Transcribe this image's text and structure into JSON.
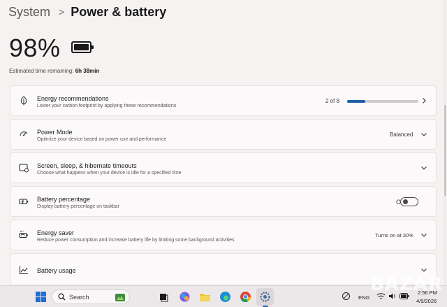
{
  "breadcrumb": {
    "parent": "System",
    "separator": ">",
    "current": "Power & battery"
  },
  "battery": {
    "percent_text": "98%",
    "percent_value": 0.98
  },
  "remaining": {
    "label": "Estimated time remaining:",
    "value": "6h 38min"
  },
  "cards": {
    "energy_recommendations": {
      "title": "Energy recommendations",
      "subtitle": "Lower your carbon footprint by applying these recommendations",
      "count": "2 of 8",
      "progress": 0.25,
      "icon": "leaf-icon"
    },
    "power_mode": {
      "title": "Power Mode",
      "subtitle": "Optimize your device based on power use and performance",
      "value": "Balanced",
      "icon": "power-mode-icon"
    },
    "screen_sleep": {
      "title": "Screen, sleep, & hibernate timeouts",
      "subtitle": "Choose what happens when your device is idle for a specified time",
      "icon": "screen-sleep-icon"
    },
    "battery_percentage": {
      "title": "Battery percentage",
      "subtitle": "Display battery percentage on taskbar",
      "value": "Off",
      "toggle_on": false,
      "icon": "battery-charging-icon"
    },
    "energy_saver": {
      "title": "Energy saver",
      "subtitle": "Reduce power consumption and increase battery life by limiting some background activities",
      "value": "Turns on at 30%",
      "icon": "energy-saver-icon"
    },
    "battery_usage": {
      "title": "Battery usage",
      "icon": "chart-line-icon"
    }
  },
  "taskbar": {
    "search_label": "Search",
    "language": "ENG",
    "time": "2:56 PM",
    "date": "4/9/2026",
    "apps": [
      "windows-start-icon",
      "search-icon",
      "widgets-icon",
      "task-view-icon",
      "copilot-icon",
      "file-explorer-icon",
      "edge-icon",
      "chrome-icon",
      "settings-icon"
    ]
  },
  "watermark": "BAZAR",
  "colors": {
    "accent": "#1f5fa8",
    "background": "#f6f2f2",
    "card": "#fbf9f9"
  }
}
